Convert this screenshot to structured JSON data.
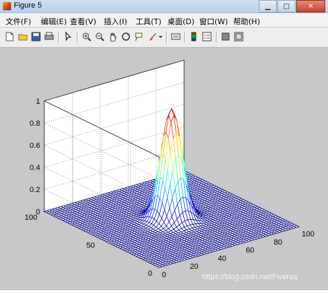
{
  "window": {
    "title": "Figure 5"
  },
  "menu": [
    {
      "label": "文件(F)"
    },
    {
      "label": "编辑(E)"
    },
    {
      "label": "查看(V)"
    },
    {
      "label": "插入(I)"
    },
    {
      "label": "工具(T)"
    },
    {
      "label": "桌面(D)"
    },
    {
      "label": "窗口(W)"
    },
    {
      "label": "帮助(H)"
    }
  ],
  "toolbar": {
    "icons": [
      "new-figure-icon",
      "open-file-icon",
      "save-icon",
      "print-icon",
      "pointer-icon",
      "zoom-in-icon",
      "zoom-out-icon",
      "pan-icon",
      "rotate-3d-icon",
      "data-cursor-icon",
      "brush-icon",
      "link-plot-icon",
      "colorbar-icon",
      "legend-icon",
      "hide-plot-tools-icon",
      "show-plot-tools-icon"
    ]
  },
  "chart_data": {
    "type": "surface-mesh",
    "title": "",
    "xlabel": "",
    "ylabel": "",
    "zlabel": "",
    "xlim": [
      0,
      100
    ],
    "ylim": [
      0,
      100
    ],
    "zlim": [
      0,
      1
    ],
    "x_ticks": [
      "0",
      "20",
      "40",
      "60",
      "80",
      "100"
    ],
    "y_ticks": [
      "0",
      "50",
      "100"
    ],
    "z_ticks": [
      "0",
      "0.2",
      "0.4",
      "0.6",
      "0.8",
      "1"
    ],
    "surface": {
      "function": "gaussian",
      "center_x": 50,
      "center_y": 50,
      "sigma": 6,
      "peak": 1,
      "colormap": "jet"
    },
    "grid": true
  },
  "watermark": "https://blog.csdn.net/Fiverya"
}
